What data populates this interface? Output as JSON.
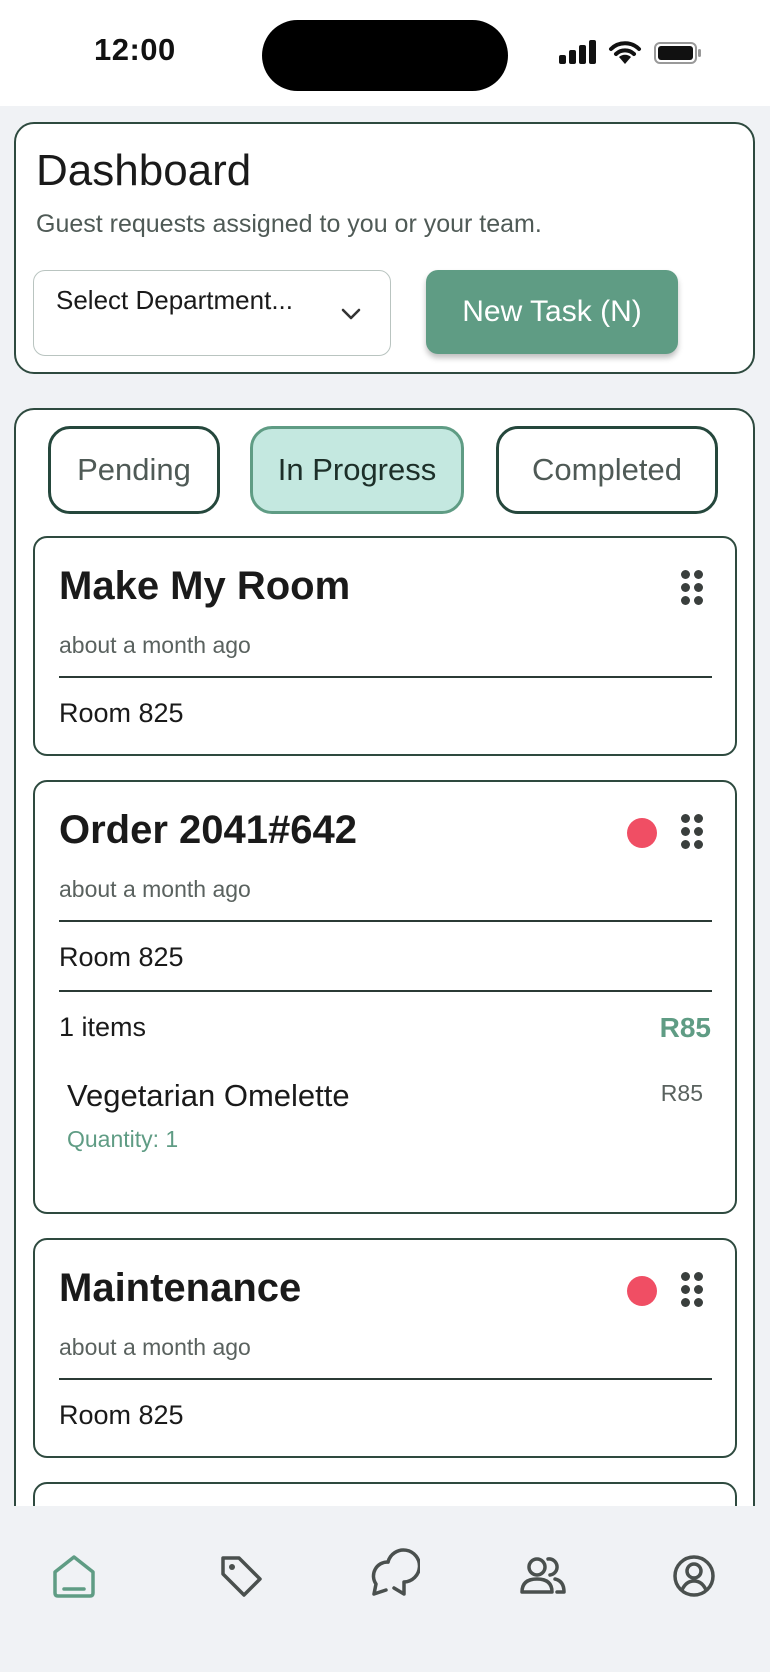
{
  "status_bar": {
    "time": "12:00"
  },
  "header": {
    "title": "Dashboard",
    "subtitle": "Guest requests assigned to you or your team.",
    "department_select": {
      "value": "Select Department..."
    },
    "new_task_label": "New Task (N)"
  },
  "tabs": [
    {
      "label": "Pending",
      "active": false
    },
    {
      "label": "In Progress",
      "active": true
    },
    {
      "label": "Completed",
      "active": false
    }
  ],
  "tasks": [
    {
      "title": "Make My Room",
      "time": "about a month ago",
      "room": "Room 825",
      "has_alert": false
    },
    {
      "title": "Order 2041#642",
      "time": "about a month ago",
      "room": "Room 825",
      "has_alert": true,
      "items_count": "1 items",
      "total": "R85",
      "items": [
        {
          "name": "Vegetarian Omelette",
          "price": "R85",
          "quantity": "Quantity: 1"
        }
      ]
    },
    {
      "title": "Maintenance",
      "time": "about a month ago",
      "room": "Room 825",
      "has_alert": true
    }
  ],
  "bottom_nav": [
    {
      "icon": "home-icon",
      "active": true
    },
    {
      "icon": "tag-icon",
      "active": false
    },
    {
      "icon": "chat-icon",
      "active": false
    },
    {
      "icon": "users-icon",
      "active": false
    },
    {
      "icon": "profile-icon",
      "active": false
    }
  ],
  "colors": {
    "accent": "#5f9c84",
    "alert": "#f04e64",
    "border": "#2e4a3f",
    "tab_active_bg": "#c4e8e0"
  }
}
